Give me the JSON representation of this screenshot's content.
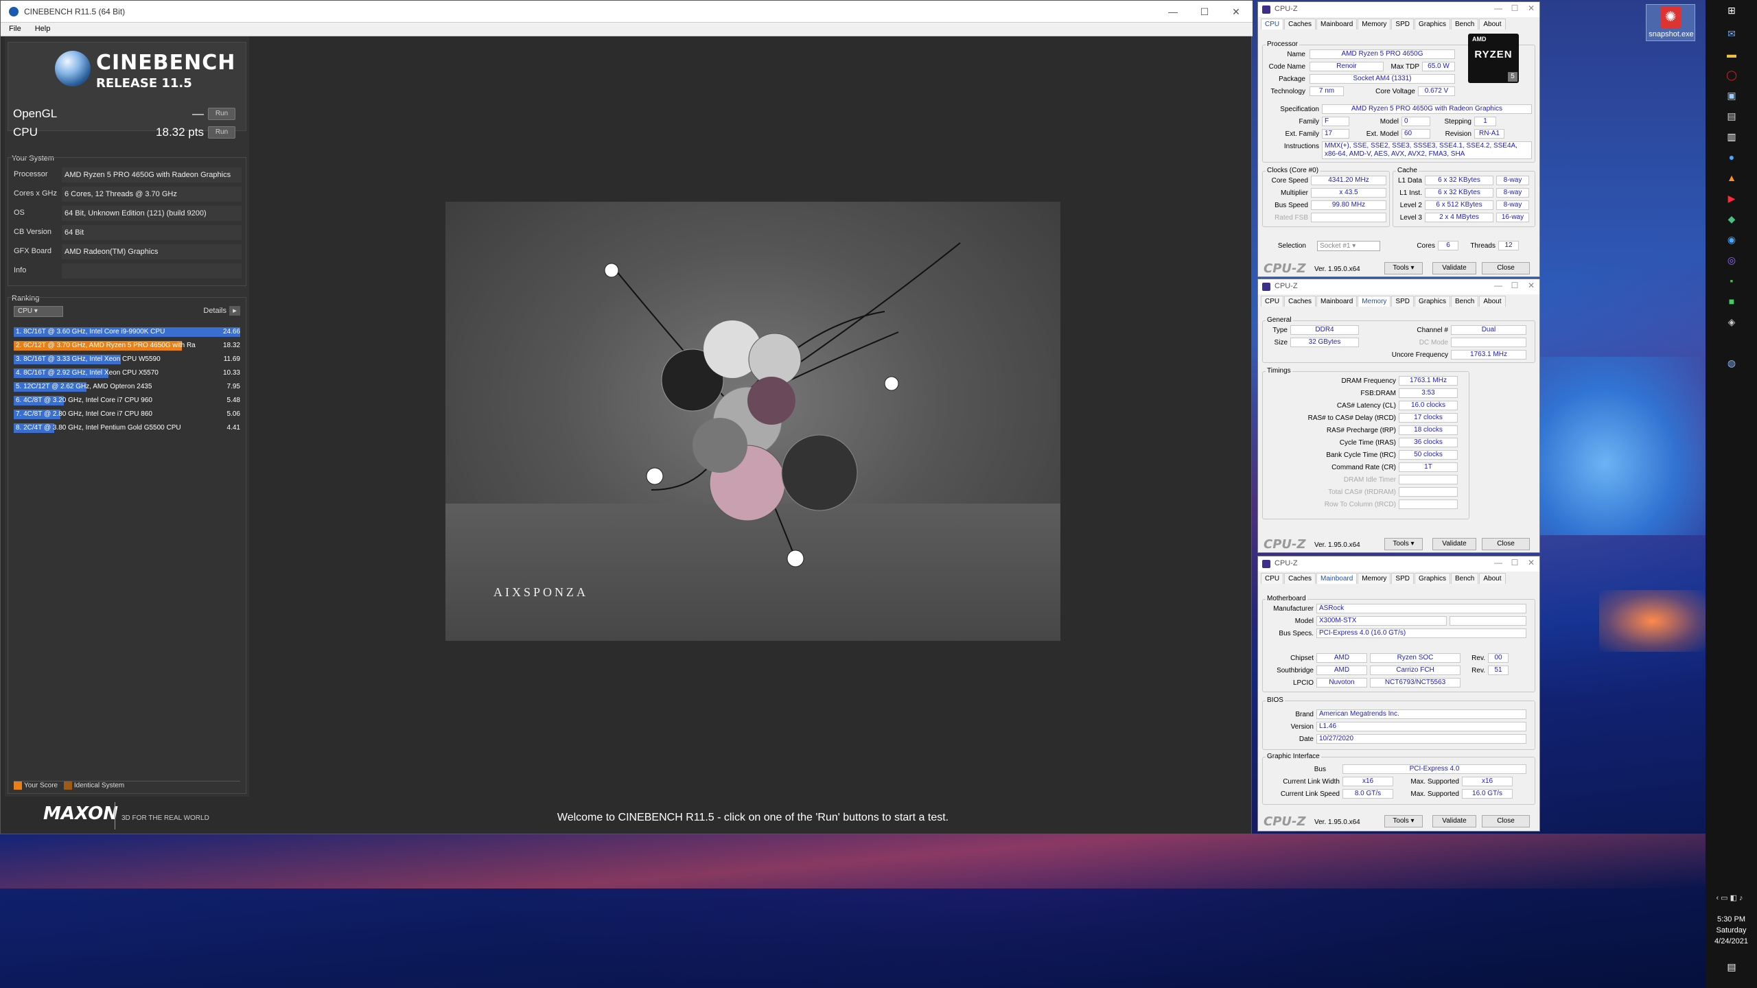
{
  "desktop": {
    "snapshot_label": "snapshot.exe"
  },
  "clock": {
    "time": "5:30 PM",
    "day": "Saturday",
    "date": "4/24/2021"
  },
  "cinebench": {
    "title": "CINEBENCH R11.5 (64 Bit)",
    "menu": [
      "File",
      "Help"
    ],
    "logo_title": "CINEBENCH",
    "logo_sub": "RELEASE 11.5",
    "opengl_label": "OpenGL",
    "opengl_value": "—",
    "cpu_label": "CPU",
    "cpu_value": "18.32 pts",
    "run_label": "Run",
    "your_system_label": "Your System",
    "system": [
      {
        "k": "Processor",
        "v": "AMD Ryzen 5 PRO 4650G with Radeon Graphics"
      },
      {
        "k": "Cores x GHz",
        "v": "6 Cores, 12 Threads @ 3.70 GHz"
      },
      {
        "k": "OS",
        "v": "64 Bit, Unknown Edition (121) (build 9200)"
      },
      {
        "k": "CB Version",
        "v": "64 Bit"
      },
      {
        "k": "GFX Board",
        "v": "AMD Radeon(TM) Graphics"
      },
      {
        "k": "Info",
        "v": ""
      }
    ],
    "ranking_label": "Ranking",
    "ranking_select": "CPU",
    "details_label": "Details",
    "ranking": [
      {
        "label": "1. 8C/16T @ 3.60 GHz, Intel Core i9-9900K CPU",
        "value": "24.66",
        "score": 24.66,
        "color": "#3a6fd0"
      },
      {
        "label": "2. 6C/12T @ 3.70 GHz, AMD Ryzen 5 PRO 4650G with Ra",
        "value": "18.32",
        "score": 18.32,
        "color": "#e8801a"
      },
      {
        "label": "3. 8C/16T @ 3.33 GHz, Intel Xeon CPU W5590",
        "value": "11.69",
        "score": 11.69,
        "color": "#3a6fd0"
      },
      {
        "label": "4. 8C/16T @ 2.92 GHz, Intel Xeon CPU X5570",
        "value": "10.33",
        "score": 10.33,
        "color": "#3a6fd0"
      },
      {
        "label": "5. 12C/12T @ 2.62 GHz, AMD Opteron 2435",
        "value": "7.95",
        "score": 7.95,
        "color": "#3a6fd0"
      },
      {
        "label": "6. 4C/8T @ 3.20 GHz, Intel Core i7 CPU 960",
        "value": "5.48",
        "score": 5.48,
        "color": "#3a6fd0"
      },
      {
        "label": "7. 4C/8T @ 2.80 GHz, Intel Core i7 CPU 860",
        "value": "5.06",
        "score": 5.06,
        "color": "#3a6fd0"
      },
      {
        "label": "8. 2C/4T @ 3.80 GHz, Intel Pentium Gold G5500 CPU",
        "value": "4.41",
        "score": 4.41,
        "color": "#3a6fd0"
      }
    ],
    "legend_your": "Your Score",
    "legend_identical": "Identical System",
    "maxon": "MAXON",
    "maxon_tag": "3D FOR THE REAL WORLD",
    "render_watermark": "AIXSPONZA",
    "status": "Welcome to CINEBENCH R11.5 - click on one of the 'Run' buttons to start a test."
  },
  "cpuz_common": {
    "title": "CPU-Z",
    "tabs": [
      "CPU",
      "Caches",
      "Mainboard",
      "Memory",
      "SPD",
      "Graphics",
      "Bench",
      "About"
    ],
    "brand": "CPU-Z",
    "version": "Ver. 1.95.0.x64",
    "tools": "Tools",
    "validate": "Validate",
    "close": "Close"
  },
  "cpuz_cpu": {
    "processor_label": "Processor",
    "name": "AMD Ryzen 5 PRO 4650G",
    "code_name": "Renoir",
    "max_tdp": "65.0 W",
    "package": "Socket AM4 (1331)",
    "technology": "7 nm",
    "core_voltage": "0.672 V",
    "specification": "AMD Ryzen 5 PRO 4650G with Radeon Graphics",
    "family": "F",
    "model": "0",
    "stepping": "1",
    "ext_family": "17",
    "ext_model": "60",
    "revision": "RN-A1",
    "instructions": "MMX(+), SSE, SSE2, SSE3, SSSE3, SSE4.1, SSE4.2, SSE4A, x86-64, AMD-V, AES, AVX, AVX2, FMA3, SHA",
    "clocks_label": "Clocks (Core #0)",
    "core_speed": "4341.20 MHz",
    "multiplier": "x 43.5",
    "bus_speed": "99.80 MHz",
    "rated_fsb": "",
    "cache_label": "Cache",
    "l1d": "6 x 32 KBytes",
    "l1d_w": "8-way",
    "l1i": "6 x 32 KBytes",
    "l1i_w": "8-way",
    "l2": "6 x 512 KBytes",
    "l2_w": "8-way",
    "l3": "2 x 4 MBytes",
    "l3_w": "16-way",
    "selection": "Socket #1",
    "cores": "6",
    "threads": "12",
    "labels": {
      "name": "Name",
      "code_name": "Code Name",
      "max_tdp": "Max TDP",
      "package": "Package",
      "technology": "Technology",
      "core_voltage": "Core Voltage",
      "specification": "Specification",
      "family": "Family",
      "model": "Model",
      "stepping": "Stepping",
      "ext_family": "Ext. Family",
      "ext_model": "Ext. Model",
      "revision": "Revision",
      "instructions": "Instructions",
      "core_speed": "Core Speed",
      "multiplier": "Multiplier",
      "bus_speed": "Bus Speed",
      "rated_fsb": "Rated FSB",
      "l1d": "L1 Data",
      "l1i": "L1 Inst.",
      "l2": "Level 2",
      "l3": "Level 3",
      "selection": "Selection",
      "cores": "Cores",
      "threads": "Threads"
    },
    "ryzen_amd": "AMD",
    "ryzen_logo": "RYZEN",
    "ryzen_num": "5"
  },
  "cpuz_mem": {
    "general_label": "General",
    "type": "DDR4",
    "size": "32 GBytes",
    "channel": "Dual",
    "dc_mode": "",
    "uncore": "1763.1 MHz",
    "timings_label": "Timings",
    "dram_freq": "1763.1 MHz",
    "fsb_dram": "3:53",
    "cl": "16.0 clocks",
    "trcd": "17 clocks",
    "trp": "18 clocks",
    "tras": "36 clocks",
    "trc": "50 clocks",
    "cr": "1T",
    "labels": {
      "type": "Type",
      "size": "Size",
      "channel": "Channel #",
      "dc_mode": "DC Mode",
      "uncore": "Uncore Frequency",
      "dram_freq": "DRAM Frequency",
      "fsb_dram": "FSB:DRAM",
      "cl": "CAS# Latency (CL)",
      "trcd": "RAS# to CAS# Delay (tRCD)",
      "trp": "RAS# Precharge (tRP)",
      "tras": "Cycle Time (tRAS)",
      "trc": "Bank Cycle Time (tRC)",
      "cr": "Command Rate (CR)",
      "idle": "DRAM Idle Timer",
      "trdram": "Total CAS# (tRDRAM)",
      "trcd2": "Row To Column (tRCD)"
    }
  },
  "cpuz_mb": {
    "motherboard_label": "Motherboard",
    "manufacturer": "ASRock",
    "model": "X300M-STX",
    "bus_specs": "PCI-Express 4.0 (16.0 GT/s)",
    "chipset_vendor": "AMD",
    "chipset": "Ryzen SOC",
    "chipset_rev": "00",
    "south_vendor": "AMD",
    "south": "Carrizo FCH",
    "south_rev": "51",
    "lpcio_vendor": "Nuvoton",
    "lpcio": "NCT6793/NCT5563",
    "bios_label": "BIOS",
    "brand": "American Megatrends Inc.",
    "version": "L1.46",
    "date": "10/27/2020",
    "gi_label": "Graphic Interface",
    "bus": "PCI-Express 4.0",
    "link_width": "x16",
    "max_width": "x16",
    "link_speed": "8.0 GT/s",
    "max_speed": "16.0 GT/s",
    "labels": {
      "manufacturer": "Manufacturer",
      "model": "Model",
      "bus_specs": "Bus Specs.",
      "chipset": "Chipset",
      "southbridge": "Southbridge",
      "lpcio": "LPCIO",
      "rev": "Rev.",
      "brand": "Brand",
      "version": "Version",
      "date": "Date",
      "bus": "Bus",
      "link_width": "Current Link Width",
      "link_speed": "Current Link Speed",
      "max_supported": "Max. Supported"
    }
  }
}
